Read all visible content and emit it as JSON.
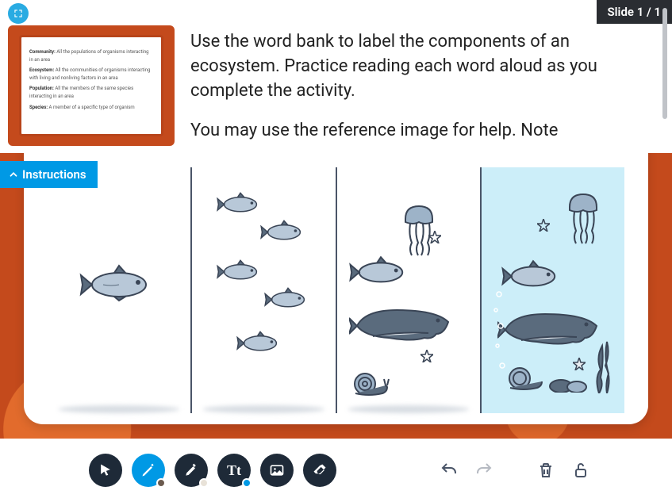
{
  "slide_counter": "Slide 1 / 1",
  "instructions_toggle": "Instructions",
  "instructions": {
    "p1": "Use the word bank to label the components of an ecosystem. Practice reading each word aloud as you complete the activity.",
    "p2": "You may use the reference image for help. Note"
  },
  "word_bank": {
    "community": {
      "term": "Community:",
      "def": "All the populations of organisms interacting in an area"
    },
    "ecosystem": {
      "term": "Ecosystem:",
      "def": "All the communities of organisms interacting with living and nonliving factors in an area"
    },
    "population": {
      "term": "Population:",
      "def": "All the members of the same species interacting in an area"
    },
    "species": {
      "term": "Species:",
      "def": "A member of a specific type of organism"
    }
  },
  "tools": {
    "pointer": "pointer",
    "pen": "pen",
    "highlighter": "highlighter",
    "text": "Tt",
    "image": "image",
    "eraser": "eraser",
    "undo": "undo",
    "redo": "redo",
    "delete": "delete",
    "lock": "unlocked"
  },
  "colors": {
    "accent": "#0099e5",
    "frame": "#c44a1c",
    "toolbar_bg": "#1e2a38"
  }
}
